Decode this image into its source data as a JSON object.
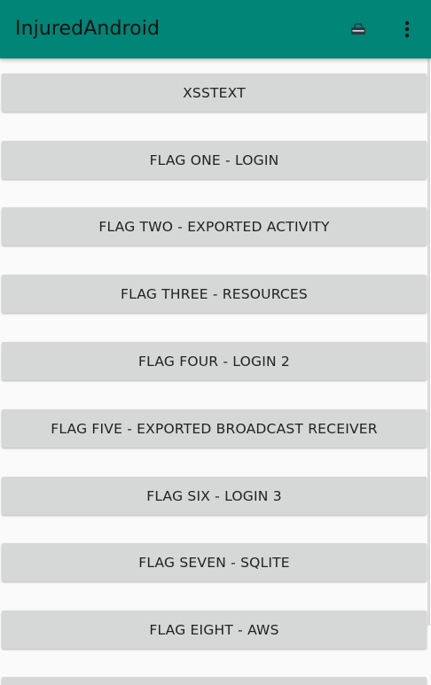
{
  "app_bar": {
    "title": "InjuredAndroid",
    "background_color": "#008577",
    "icons": [
      "lock-icon",
      "overflow-menu-icon"
    ]
  },
  "buttons": [
    {
      "label": "XSSTEXT"
    },
    {
      "label": "FLAG ONE - LOGIN"
    },
    {
      "label": "FLAG TWO - EXPORTED ACTIVITY"
    },
    {
      "label": "FLAG THREE - RESOURCES"
    },
    {
      "label": "FLAG FOUR - LOGIN 2"
    },
    {
      "label": "FLAG FIVE - EXPORTED BROADCAST RECEIVER"
    },
    {
      "label": "FLAG SIX - LOGIN 3"
    },
    {
      "label": "FLAG SEVEN - SQLITE"
    },
    {
      "label": "FLAG EIGHT - AWS"
    }
  ],
  "colors": {
    "button_background": "#d6d7d7",
    "page_background": "#fafafa"
  }
}
